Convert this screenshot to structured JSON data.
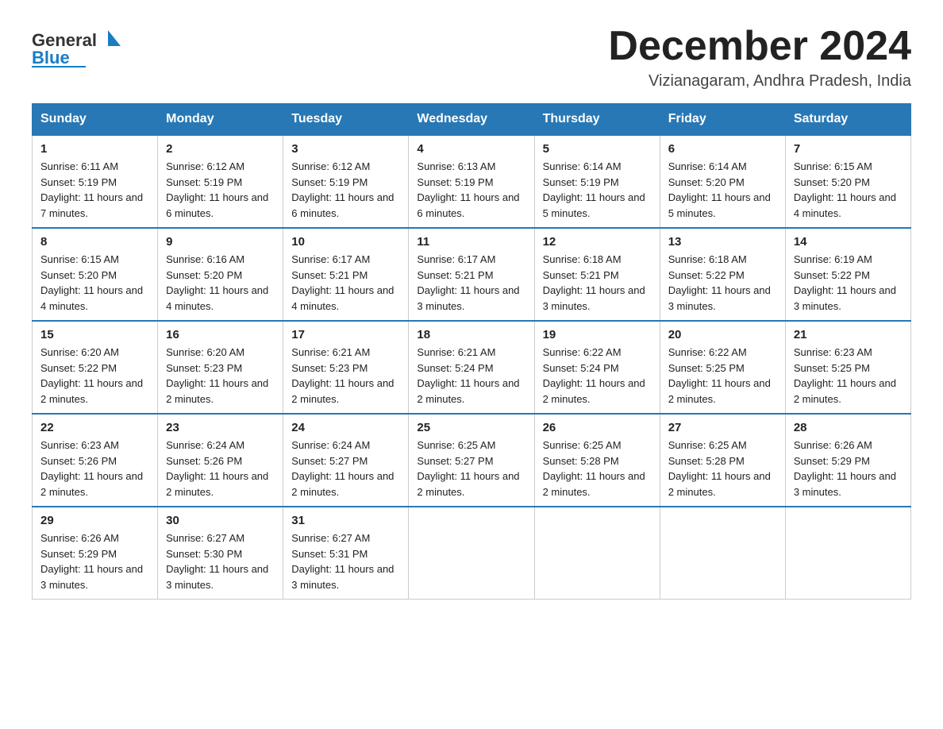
{
  "header": {
    "logo_general": "General",
    "logo_blue": "Blue",
    "month_title": "December 2024",
    "location": "Vizianagaram, Andhra Pradesh, India"
  },
  "weekdays": [
    "Sunday",
    "Monday",
    "Tuesday",
    "Wednesday",
    "Thursday",
    "Friday",
    "Saturday"
  ],
  "weeks": [
    [
      {
        "day": "1",
        "sunrise": "6:11 AM",
        "sunset": "5:19 PM",
        "daylight": "11 hours and 7 minutes."
      },
      {
        "day": "2",
        "sunrise": "6:12 AM",
        "sunset": "5:19 PM",
        "daylight": "11 hours and 6 minutes."
      },
      {
        "day": "3",
        "sunrise": "6:12 AM",
        "sunset": "5:19 PM",
        "daylight": "11 hours and 6 minutes."
      },
      {
        "day": "4",
        "sunrise": "6:13 AM",
        "sunset": "5:19 PM",
        "daylight": "11 hours and 6 minutes."
      },
      {
        "day": "5",
        "sunrise": "6:14 AM",
        "sunset": "5:19 PM",
        "daylight": "11 hours and 5 minutes."
      },
      {
        "day": "6",
        "sunrise": "6:14 AM",
        "sunset": "5:20 PM",
        "daylight": "11 hours and 5 minutes."
      },
      {
        "day": "7",
        "sunrise": "6:15 AM",
        "sunset": "5:20 PM",
        "daylight": "11 hours and 4 minutes."
      }
    ],
    [
      {
        "day": "8",
        "sunrise": "6:15 AM",
        "sunset": "5:20 PM",
        "daylight": "11 hours and 4 minutes."
      },
      {
        "day": "9",
        "sunrise": "6:16 AM",
        "sunset": "5:20 PM",
        "daylight": "11 hours and 4 minutes."
      },
      {
        "day": "10",
        "sunrise": "6:17 AM",
        "sunset": "5:21 PM",
        "daylight": "11 hours and 4 minutes."
      },
      {
        "day": "11",
        "sunrise": "6:17 AM",
        "sunset": "5:21 PM",
        "daylight": "11 hours and 3 minutes."
      },
      {
        "day": "12",
        "sunrise": "6:18 AM",
        "sunset": "5:21 PM",
        "daylight": "11 hours and 3 minutes."
      },
      {
        "day": "13",
        "sunrise": "6:18 AM",
        "sunset": "5:22 PM",
        "daylight": "11 hours and 3 minutes."
      },
      {
        "day": "14",
        "sunrise": "6:19 AM",
        "sunset": "5:22 PM",
        "daylight": "11 hours and 3 minutes."
      }
    ],
    [
      {
        "day": "15",
        "sunrise": "6:20 AM",
        "sunset": "5:22 PM",
        "daylight": "11 hours and 2 minutes."
      },
      {
        "day": "16",
        "sunrise": "6:20 AM",
        "sunset": "5:23 PM",
        "daylight": "11 hours and 2 minutes."
      },
      {
        "day": "17",
        "sunrise": "6:21 AM",
        "sunset": "5:23 PM",
        "daylight": "11 hours and 2 minutes."
      },
      {
        "day": "18",
        "sunrise": "6:21 AM",
        "sunset": "5:24 PM",
        "daylight": "11 hours and 2 minutes."
      },
      {
        "day": "19",
        "sunrise": "6:22 AM",
        "sunset": "5:24 PM",
        "daylight": "11 hours and 2 minutes."
      },
      {
        "day": "20",
        "sunrise": "6:22 AM",
        "sunset": "5:25 PM",
        "daylight": "11 hours and 2 minutes."
      },
      {
        "day": "21",
        "sunrise": "6:23 AM",
        "sunset": "5:25 PM",
        "daylight": "11 hours and 2 minutes."
      }
    ],
    [
      {
        "day": "22",
        "sunrise": "6:23 AM",
        "sunset": "5:26 PM",
        "daylight": "11 hours and 2 minutes."
      },
      {
        "day": "23",
        "sunrise": "6:24 AM",
        "sunset": "5:26 PM",
        "daylight": "11 hours and 2 minutes."
      },
      {
        "day": "24",
        "sunrise": "6:24 AM",
        "sunset": "5:27 PM",
        "daylight": "11 hours and 2 minutes."
      },
      {
        "day": "25",
        "sunrise": "6:25 AM",
        "sunset": "5:27 PM",
        "daylight": "11 hours and 2 minutes."
      },
      {
        "day": "26",
        "sunrise": "6:25 AM",
        "sunset": "5:28 PM",
        "daylight": "11 hours and 2 minutes."
      },
      {
        "day": "27",
        "sunrise": "6:25 AM",
        "sunset": "5:28 PM",
        "daylight": "11 hours and 2 minutes."
      },
      {
        "day": "28",
        "sunrise": "6:26 AM",
        "sunset": "5:29 PM",
        "daylight": "11 hours and 3 minutes."
      }
    ],
    [
      {
        "day": "29",
        "sunrise": "6:26 AM",
        "sunset": "5:29 PM",
        "daylight": "11 hours and 3 minutes."
      },
      {
        "day": "30",
        "sunrise": "6:27 AM",
        "sunset": "5:30 PM",
        "daylight": "11 hours and 3 minutes."
      },
      {
        "day": "31",
        "sunrise": "6:27 AM",
        "sunset": "5:31 PM",
        "daylight": "11 hours and 3 minutes."
      },
      null,
      null,
      null,
      null
    ]
  ]
}
